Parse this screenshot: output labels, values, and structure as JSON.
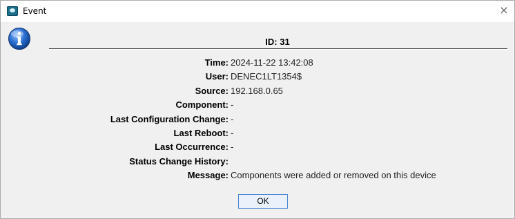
{
  "window": {
    "title": "Event",
    "close_glyph": "×"
  },
  "header": {
    "id_text": "ID: 31"
  },
  "fields": [
    {
      "label": "Time:",
      "value": "2024-11-22 13:42:08"
    },
    {
      "label": "User:",
      "value": "DENEC1LT1354$"
    },
    {
      "label": "Source:",
      "value": "192.168.0.65"
    },
    {
      "label": "Component:",
      "value": "-"
    },
    {
      "label": "Last Configuration Change:",
      "value": "-"
    },
    {
      "label": "Last Reboot:",
      "value": "-"
    },
    {
      "label": "Last Occurrence:",
      "value": "-"
    },
    {
      "label": "Status Change History:",
      "value": ""
    },
    {
      "label": "Message:",
      "value": "Components were added or removed on this device"
    }
  ],
  "buttons": {
    "ok_label": "OK"
  },
  "icons": {
    "app": "app-icon",
    "info": "info-icon",
    "close": "close-icon"
  },
  "colors": {
    "info_blue": "#1d5fbf",
    "button_border": "#4a86d4"
  }
}
